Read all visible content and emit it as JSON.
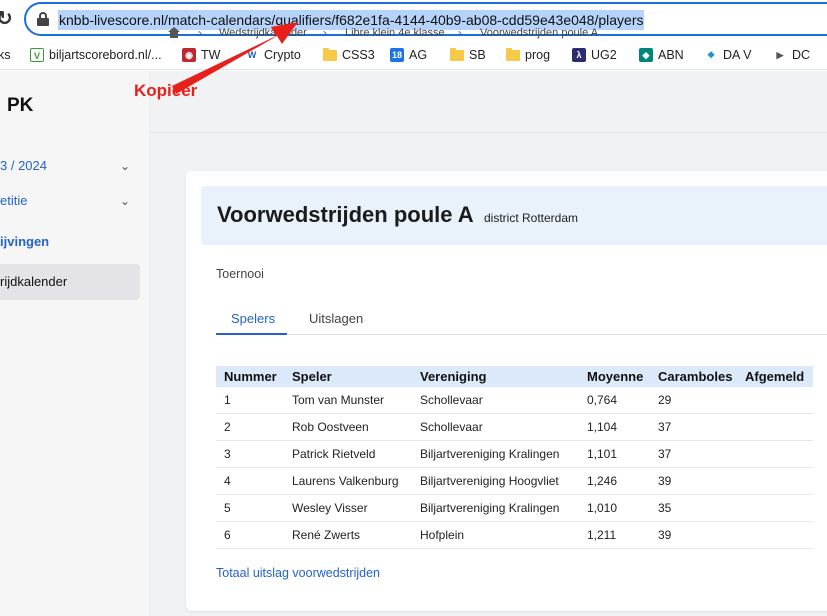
{
  "browser": {
    "url": "knbb-livescore.nl/match-calendars/qualifiers/f682e1fa-4144-40b9-ab08-cdd59e43e048/players",
    "bookmarks": [
      {
        "label": "ks",
        "icon": "none"
      },
      {
        "label": "biljartscorebord.nl/...",
        "icon": "v-logo-icon"
      },
      {
        "label": "TW",
        "icon": "tw-icon"
      },
      {
        "label": "Crypto",
        "icon": "w-logo-icon"
      },
      {
        "label": "CSS3",
        "icon": "folder-icon"
      },
      {
        "label": "AG",
        "icon": "calendar-icon"
      },
      {
        "label": "SB",
        "icon": "folder-icon"
      },
      {
        "label": "prog",
        "icon": "folder-icon"
      },
      {
        "label": "UG2",
        "icon": "lambda-icon"
      },
      {
        "label": "ABN",
        "icon": "shield-icon"
      },
      {
        "label": "DA V",
        "icon": "diamond-icon"
      },
      {
        "label": "DC",
        "icon": "play-icon"
      }
    ]
  },
  "sidebar": {
    "logo": "PK",
    "items": [
      {
        "label": "3 / 2024",
        "has_chevron": true
      },
      {
        "label": "etitie",
        "has_chevron": true
      },
      {
        "label": "ijvingen",
        "has_chevron": false
      },
      {
        "label": "rijdkalender",
        "has_chevron": false,
        "active": true
      }
    ]
  },
  "breadcrumb": [
    "Wedstrijdkalender",
    "Libre klein 4e klasse",
    "Voorwedstrijden poule A"
  ],
  "page": {
    "title": "Voorwedstrijden poule A",
    "subtitle": "district Rotterdam",
    "section": "Toernooi",
    "tabs": [
      "Spelers",
      "Uitslagen"
    ],
    "footer_link": "Totaal uitslag voorwedstrijden"
  },
  "table": {
    "headers": [
      "Nummer",
      "Speler",
      "Vereniging",
      "Moyenne",
      "Caramboles",
      "Afgemeld"
    ],
    "rows": [
      [
        "1",
        "Tom van Munster",
        "Schollevaar",
        "0,764",
        "29",
        ""
      ],
      [
        "2",
        "Rob Oostveen",
        "Schollevaar",
        "1,104",
        "37",
        ""
      ],
      [
        "3",
        "Patrick Rietveld",
        "Biljartvereniging Kralingen",
        "1,101",
        "37",
        ""
      ],
      [
        "4",
        "Laurens Valkenburg",
        "Biljartvereniging Hoogvliet",
        "1,246",
        "39",
        ""
      ],
      [
        "5",
        "Wesley Visser",
        "Biljartvereniging Kralingen",
        "1,010",
        "35",
        ""
      ],
      [
        "6",
        "René Zwerts",
        "Hofplein",
        "1,211",
        "39",
        ""
      ]
    ]
  },
  "annotation": {
    "label": "Kopieer",
    "color": "#e8201c"
  },
  "colors": {
    "accent": "#2563c9",
    "url_highlight": "#b5d3fb",
    "table_header": "#dce9fa"
  }
}
